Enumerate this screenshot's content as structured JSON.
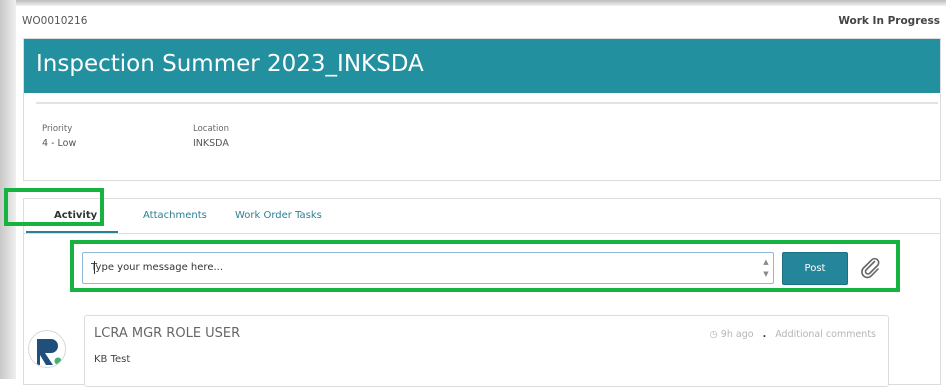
{
  "work_order": {
    "id": "WO0010216",
    "status": "Work In Progress",
    "title": "Inspection Summer 2023_INKSDA",
    "fields": [
      {
        "label": "Priority",
        "value": "4 - Low"
      },
      {
        "label": "Location",
        "value": "INKSDA"
      }
    ]
  },
  "tabs": [
    {
      "label": "Activity",
      "active": true
    },
    {
      "label": "Attachments",
      "active": false
    },
    {
      "label": "Work Order Tasks",
      "active": false
    }
  ],
  "composer": {
    "placeholder": "Type your message here...",
    "value": "",
    "post_label": "Post",
    "attach_icon": "paperclip-icon"
  },
  "activity": [
    {
      "author": "LCRA MGR ROLE USER",
      "time_icon": "clock-icon",
      "time": "9h ago",
      "type": "Additional comments",
      "body": "KB Test"
    }
  ],
  "colors": {
    "header_bg": "#23909f",
    "accent": "#25859a",
    "highlight": "#16b340",
    "link": "#2d7f92"
  }
}
